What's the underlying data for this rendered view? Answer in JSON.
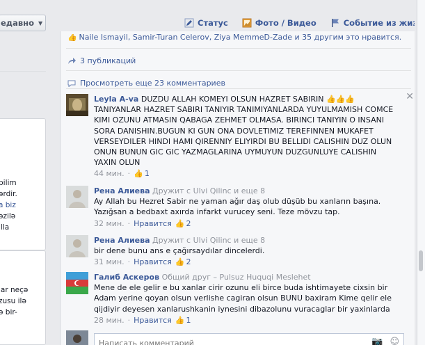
{
  "left": {
    "sort_label": "едавно",
    "card1_lines": [
      "bilim",
      "ərdir.",
      "a biz",
      "əzilə",
      "illa"
    ],
    "card2_lines": [
      "lar neçə",
      "zusu ilə",
      "ə bir-"
    ]
  },
  "composer": {
    "status": "Статус",
    "photo": "Фото / Видео",
    "life_event": "Событие из жизни"
  },
  "post": {
    "likes_text": "Naile Ismayil, Samir-Turan Celerov, Ziya MemmeD-Zade и 35 другим это нравится.",
    "shares": "3 публикаций",
    "view_more": "Просмотреть еще 23 комментариев"
  },
  "comments": [
    {
      "author": "Leyla A-va",
      "subtitle": "",
      "text": "DUZDU ALLAH KOMEYI OLSUN HAZRET SABIRIN 👍👍👍 TANIYANLAR HAZRET SABIRI TANIYIR TANIMIYANLARDA YUYULMAMISH COMCE KIMI OZUNU ATMASIN QABAGA ZEHMET OLMASA. BIRINCI TANIYIN O INSANI SORA DANISHIN.BUGUN KI GUN ONA DOVLETIMIZ TEREFINNEN MUKAFET VERSEYDILER HINDI HAMI QIRENNIY ELIYIRDI BU BELLIDI CALISHIN DUZ OLUN ONUN BUNUN GIC GIC YAZMAGLARINA UYMUYUN DUZGUNLUYE CALISHIN YAXIN OLUN",
      "time": "44 мин.",
      "like_label": "",
      "likes": "1"
    },
    {
      "author": "Рена Алиева",
      "subtitle": "Дружит с Ulvi Qilinc и еще 8",
      "text": "Ay Allah bu Hezret Sabir ne yaman ağır daş olub düşüb bu xanların başına. Yazığsan a bedbaxt axırda infarkt vurucey seni. Teze mövzu tap.",
      "time": "32 мин.",
      "like_label": "Нравится",
      "likes": "2"
    },
    {
      "author": "Рена Алиева",
      "subtitle": "Дружит с Ulvi Qilinc и еще 8",
      "text": "bir dene bunu ans e çağırsaydılar dincelerdi.",
      "time": "31 мин.",
      "like_label": "Нравится",
      "likes": "2"
    },
    {
      "author": "Галиб Аскеров",
      "subtitle": "Общий друг – Pulsuz Huquqi Meslehet",
      "text": "Mene de ele gelir e bu xanlar cirir ozunu eli birce buda ishtimayete cixsin bir Adam yerine qoyan olsun verlishe cagiran olsun BUNU baxiram Kime qelir ele qijdiyir deyesen xanlarushkanin iynesini dibazolunu vuracaglar bir yaxinlarda",
      "time": "28 мин.",
      "like_label": "Нравится",
      "likes": "1"
    }
  ],
  "write_comment": {
    "placeholder": "Написать комментарий"
  },
  "colors": {
    "link": "#3b5998",
    "muted": "#90949c",
    "card_bg": "#f6f7f9"
  }
}
